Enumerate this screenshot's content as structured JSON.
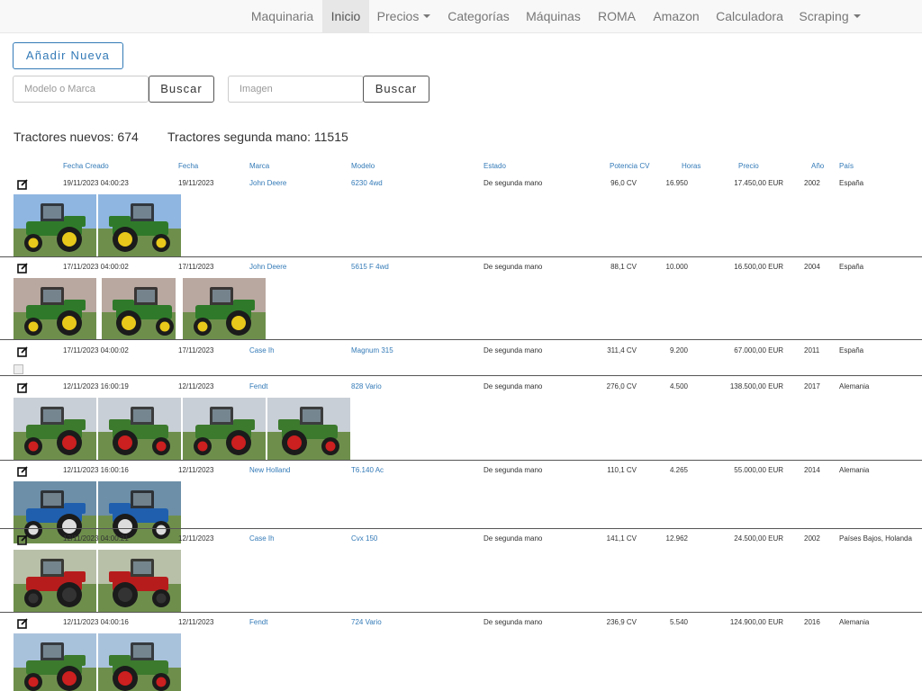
{
  "nav": {
    "items": [
      {
        "label": "Maquinaria"
      },
      {
        "label": "Inicio"
      },
      {
        "label": "Precios"
      },
      {
        "label": "Categorías"
      },
      {
        "label": "Máquinas"
      },
      {
        "label": "ROMA"
      },
      {
        "label": "Amazon"
      },
      {
        "label": "Calculadora"
      },
      {
        "label": "Scraping"
      }
    ]
  },
  "actions": {
    "new_label": "Añadir Nueva",
    "search_placeholder": "Modelo o Marca",
    "search_button": "Buscar",
    "image_placeholder": "Imagen",
    "image_button": "Buscar"
  },
  "stats": {
    "new_text": "Tractores nuevos: 674",
    "used_text": "Tractores segunda mano: 11515"
  },
  "table": {
    "headers": [
      "Fecha Creado",
      "Fecha",
      "Marca",
      "Modelo",
      "Estado",
      "Potencia CV",
      "Horas",
      "Precio",
      "Año",
      "País"
    ],
    "rows": [
      {
        "created": "19/11/2023 04:00:23",
        "date": "19/11/2023",
        "brand": "John Deere",
        "model": "6230 4wd",
        "status": "De segunda mano",
        "power": "96,0 CV",
        "hours": "16.950",
        "price": "17.450,00 EUR",
        "year": "2002",
        "country": "España",
        "images": 2,
        "body": "#2f7a2a",
        "wheel": "#e8c81a",
        "sky": "#8fb6e0"
      },
      {
        "created": "17/11/2023 04:00:02",
        "date": "17/11/2023",
        "brand": "John Deere",
        "model": "5615 F 4wd",
        "status": "De segunda mano",
        "power": "88,1 CV",
        "hours": "10.000",
        "price": "16.500,00 EUR",
        "year": "2004",
        "country": "España",
        "images": 3,
        "body": "#2f7a2a",
        "wheel": "#e8c81a",
        "sky": "#b9a8a0"
      },
      {
        "created": "17/11/2023 04:00:02",
        "date": "17/11/2023",
        "brand": "Case Ih",
        "model": "Magnum 315",
        "status": "De segunda mano",
        "power": "311,4 CV",
        "hours": "9.200",
        "price": "67.000,00 EUR",
        "year": "2011",
        "country": "España",
        "images": 0,
        "body": "#c01818",
        "wheel": "#222",
        "sky": "#ccc"
      },
      {
        "created": "12/11/2023 16:00:19",
        "date": "12/11/2023",
        "brand": "Fendt",
        "model": "828 Vario",
        "status": "De segunda mano",
        "power": "276,0 CV",
        "hours": "4.500",
        "price": "138.500,00 EUR",
        "year": "2017",
        "country": "Alemania",
        "images": 4,
        "body": "#3c7a2e",
        "wheel": "#cc1f1f",
        "sky": "#c9cfd6"
      },
      {
        "created": "12/11/2023 16:00:16",
        "date": "12/11/2023",
        "brand": "New Holland",
        "model": "T6.140 Ac",
        "status": "De segunda mano",
        "power": "110,1 CV",
        "hours": "4.265",
        "price": "55.000,00 EUR",
        "year": "2014",
        "country": "Alemania",
        "images": 2,
        "body": "#1f5fae",
        "wheel": "#ddd",
        "sky": "#6d8fa8"
      },
      {
        "created": "12/11/2023 04:00:21",
        "date": "12/11/2023",
        "brand": "Case Ih",
        "model": "Cvx 150",
        "status": "De segunda mano",
        "power": "141,1 CV",
        "hours": "12.962",
        "price": "24.500,00 EUR",
        "year": "2002",
        "country": "Países Bajos, Holanda",
        "images": 2,
        "body": "#b71c1c",
        "wheel": "#333",
        "sky": "#b8c0a8"
      },
      {
        "created": "12/11/2023 04:00:16",
        "date": "12/11/2023",
        "brand": "Fendt",
        "model": "724 Vario",
        "status": "De segunda mano",
        "power": "236,9 CV",
        "hours": "5.540",
        "price": "124.900,00 EUR",
        "year": "2016",
        "country": "Alemania",
        "images": 2,
        "body": "#3c7a2e",
        "wheel": "#cc1f1f",
        "sky": "#a9c2dc"
      }
    ]
  }
}
